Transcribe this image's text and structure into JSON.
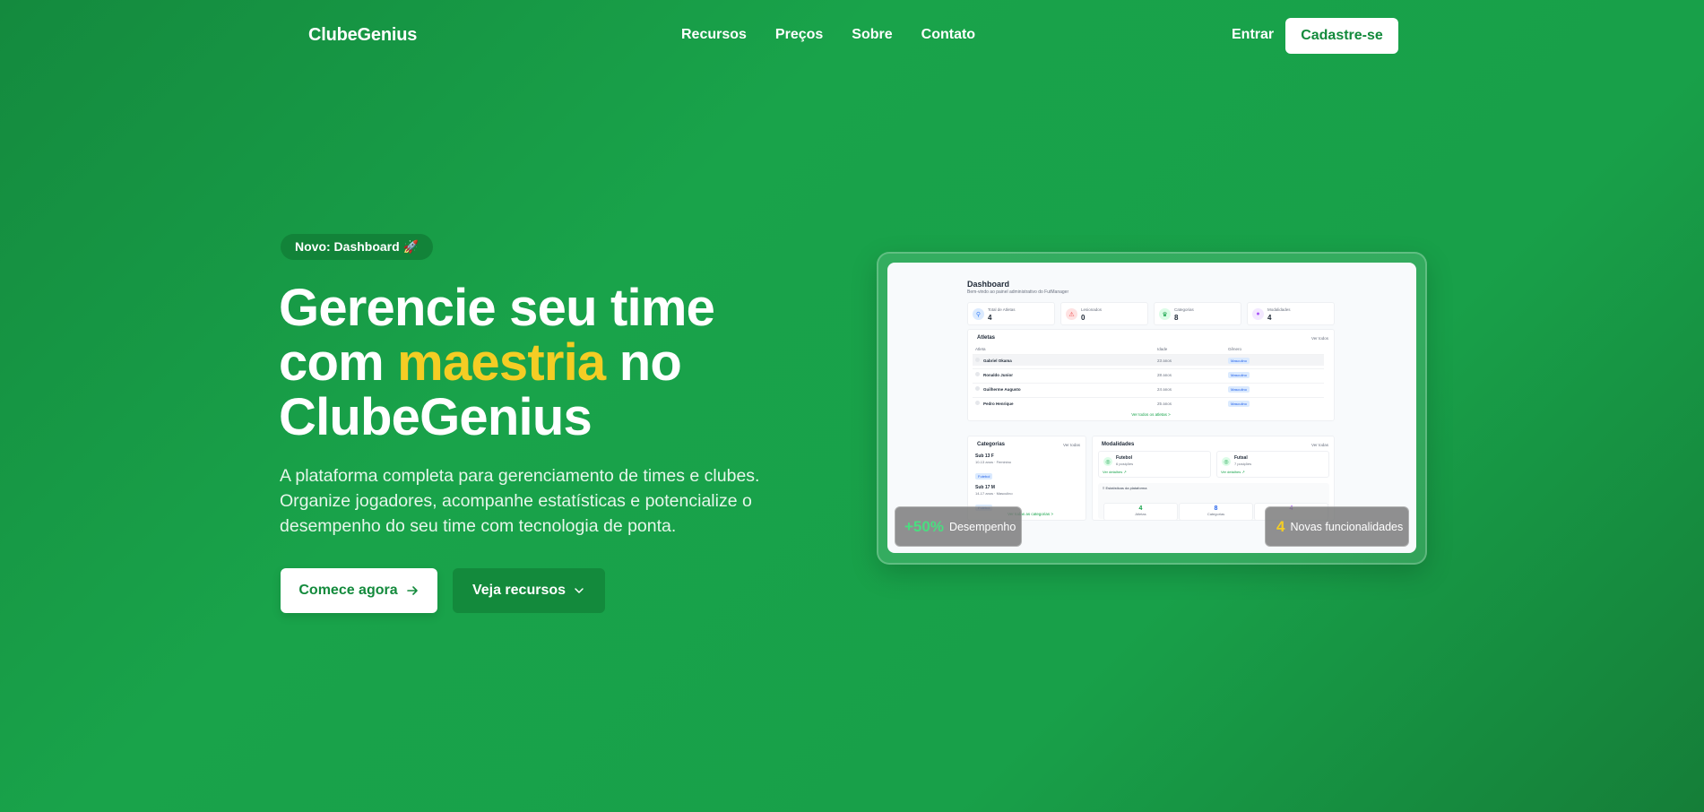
{
  "nav": {
    "logo": "ClubeGenius",
    "links": [
      "Recursos",
      "Preços",
      "Sobre",
      "Contato"
    ],
    "login": "Entrar",
    "signup": "Cadastre-se"
  },
  "hero": {
    "badge": "Novo: Dashboard 🚀",
    "headline_part1": "Gerencie seu time com ",
    "headline_accent": "maestria",
    "headline_part2": " no ClubeGenius",
    "subtitle": "A plataforma completa para gerenciamento de times e clubes. Organize jogadores, acompanhe estatísticas e potencialize o desempenho do seu time com tecnologia de ponta.",
    "primary_button": "Comece agora",
    "secondary_button": "Veja recursos"
  },
  "mockup": {
    "title": "Dashboard",
    "subtitle": "Bem-vindo ao painel administrativo do FutManager",
    "stats": [
      {
        "label": "Total de Atletas",
        "value": "4",
        "icon": "user-icon",
        "color": "#3b82f6",
        "bg": "#dbeafe"
      },
      {
        "label": "Lesionados",
        "value": "0",
        "icon": "alert-icon",
        "color": "#ef4444",
        "bg": "#fee2e2"
      },
      {
        "label": "Categorias",
        "value": "8",
        "icon": "trophy-icon",
        "color": "#16a34a",
        "bg": "#dcfce7"
      },
      {
        "label": "Modalidades",
        "value": "4",
        "icon": "ball-icon",
        "color": "#a855f7",
        "bg": "#f3e8ff"
      }
    ],
    "athletes": {
      "title": "Atletas",
      "link": "Ver todos",
      "headers": [
        "Atleta",
        "Idade",
        "Gênero"
      ],
      "rows": [
        {
          "name": "Gabriel Okama",
          "age": "23 anos",
          "gender": "Masculino"
        },
        {
          "name": "Ronaldo Junior",
          "age": "28 anos",
          "gender": "Masculino"
        },
        {
          "name": "Guilherme Augusto",
          "age": "24 anos",
          "gender": "Masculino"
        },
        {
          "name": "Pedro Henrique",
          "age": "25 anos",
          "gender": "Masculino"
        }
      ],
      "see_all": "Ver todos os atletas >"
    },
    "categories": {
      "title": "Categorias",
      "link": "Ver todas",
      "items": [
        {
          "name": "Sub 13 F",
          "detail": "10-13 anos · Feminino",
          "tag": "Futebol"
        },
        {
          "name": "Sub 17 M",
          "detail": "14-17 anos · Masculino",
          "tag": "Futebol"
        }
      ],
      "see_all": "Ver todas as categorias >"
    },
    "modalities": {
      "title": "Modalidades",
      "link": "Ver todas",
      "items": [
        {
          "name": "Futebol",
          "positions": "6 posições",
          "detail": "Ver detalhes ↗"
        },
        {
          "name": "Futsal",
          "positions": "7 posições",
          "detail": "Ver detalhes ↗"
        }
      ],
      "platform_title": "≡ Estatísticas da plataforma",
      "platform_stats": [
        {
          "value": "4",
          "label": "Atletas",
          "color": "#16a34a"
        },
        {
          "value": "8",
          "label": "Categorias",
          "color": "#2563eb"
        },
        {
          "value": "4",
          "label": "",
          "color": "#a855f7"
        }
      ]
    },
    "overlay_left": {
      "value": "+50%",
      "label": "Desempenho"
    },
    "overlay_right": {
      "value": "4",
      "label": "Novas funcionalidades"
    }
  },
  "colors": {
    "accent": "#f4cd24",
    "brand": "#16a34a",
    "success_text": "#4ade80"
  }
}
